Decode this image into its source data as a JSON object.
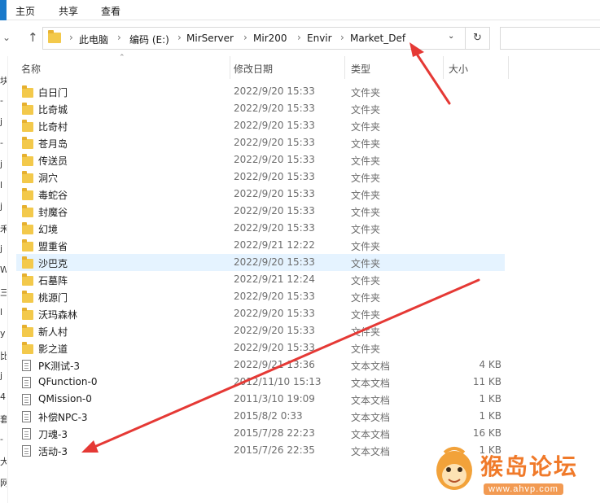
{
  "ribbon": {
    "tabs": [
      "主页",
      "共享",
      "查看"
    ]
  },
  "address_bar": {
    "crumbs": [
      "此电脑",
      "编码 (E:)",
      "MirServer",
      "Mir200",
      "Envir",
      "Market_Def"
    ]
  },
  "columns": {
    "name": "名称",
    "date": "修改日期",
    "type": "类型",
    "size": "大小"
  },
  "nav_pane_glyphs": [
    "块",
    "-",
    "j",
    "-",
    "j",
    "l",
    "j",
    "禾",
    "j",
    "W",
    "三",
    "l",
    "y",
    "比",
    "j",
    "4",
    "套",
    "-",
    "大",
    "网"
  ],
  "files": [
    {
      "name": "白日门",
      "date": "2022/9/20 15:33",
      "type": "文件夹",
      "size": "",
      "kind": "folder"
    },
    {
      "name": "比奇城",
      "date": "2022/9/20 15:33",
      "type": "文件夹",
      "size": "",
      "kind": "folder"
    },
    {
      "name": "比奇村",
      "date": "2022/9/20 15:33",
      "type": "文件夹",
      "size": "",
      "kind": "folder"
    },
    {
      "name": "苍月岛",
      "date": "2022/9/20 15:33",
      "type": "文件夹",
      "size": "",
      "kind": "folder"
    },
    {
      "name": "传送员",
      "date": "2022/9/20 15:33",
      "type": "文件夹",
      "size": "",
      "kind": "folder"
    },
    {
      "name": "洞穴",
      "date": "2022/9/20 15:33",
      "type": "文件夹",
      "size": "",
      "kind": "folder"
    },
    {
      "name": "毒蛇谷",
      "date": "2022/9/20 15:33",
      "type": "文件夹",
      "size": "",
      "kind": "folder"
    },
    {
      "name": "封魔谷",
      "date": "2022/9/20 15:33",
      "type": "文件夹",
      "size": "",
      "kind": "folder"
    },
    {
      "name": "幻境",
      "date": "2022/9/20 15:33",
      "type": "文件夹",
      "size": "",
      "kind": "folder"
    },
    {
      "name": "盟重省",
      "date": "2022/9/21 12:22",
      "type": "文件夹",
      "size": "",
      "kind": "folder"
    },
    {
      "name": "沙巴克",
      "date": "2022/9/20 15:33",
      "type": "文件夹",
      "size": "",
      "kind": "folder",
      "selected": true
    },
    {
      "name": "石墓阵",
      "date": "2022/9/21 12:24",
      "type": "文件夹",
      "size": "",
      "kind": "folder"
    },
    {
      "name": "桃源门",
      "date": "2022/9/20 15:33",
      "type": "文件夹",
      "size": "",
      "kind": "folder"
    },
    {
      "name": "沃玛森林",
      "date": "2022/9/20 15:33",
      "type": "文件夹",
      "size": "",
      "kind": "folder"
    },
    {
      "name": "新人村",
      "date": "2022/9/20 15:33",
      "type": "文件夹",
      "size": "",
      "kind": "folder"
    },
    {
      "name": "影之道",
      "date": "2022/9/20 15:33",
      "type": "文件夹",
      "size": "",
      "kind": "folder"
    },
    {
      "name": "PK测试-3",
      "date": "2022/9/21 13:36",
      "type": "文本文档",
      "size": "4 KB",
      "kind": "doc"
    },
    {
      "name": "QFunction-0",
      "date": "2012/11/10 15:13",
      "type": "文本文档",
      "size": "11 KB",
      "kind": "doc"
    },
    {
      "name": "QMission-0",
      "date": "2011/3/10 19:09",
      "type": "文本文档",
      "size": "1 KB",
      "kind": "doc"
    },
    {
      "name": "补偿NPC-3",
      "date": "2015/8/2 0:33",
      "type": "文本文档",
      "size": "1 KB",
      "kind": "doc"
    },
    {
      "name": "刀魂-3",
      "date": "2015/7/28 22:23",
      "type": "文本文档",
      "size": "16 KB",
      "kind": "doc"
    },
    {
      "name": "活动-3",
      "date": "2015/7/26 22:35",
      "type": "文本文档",
      "size": "1 KB",
      "kind": "doc"
    }
  ],
  "watermark": {
    "name": "猴岛论坛",
    "url": "www.ahvp.com"
  },
  "colors": {
    "folder": "#f3c94b",
    "selection": "#e5f3ff",
    "arrow": "#e53935",
    "watermark": "#f07a2a"
  }
}
